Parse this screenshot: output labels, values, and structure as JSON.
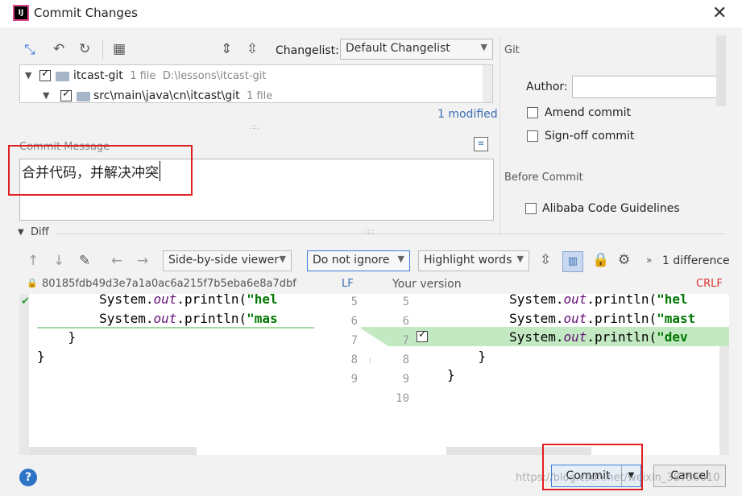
{
  "window": {
    "title": "Commit Changes"
  },
  "toolbar": {
    "changelist_label": "Changelist:",
    "changelist_value": "Default Changelist"
  },
  "git": {
    "section": "Git",
    "author_label": "Author:",
    "author_value": "",
    "amend": "Amend commit",
    "signoff": "Sign-off commit",
    "before_commit": "Before Commit",
    "alibaba": "Alibaba Code Guidelines"
  },
  "tree": {
    "root_name": "itcast-git",
    "root_count": "1 file",
    "root_path": "D:\\lessons\\itcast-git",
    "child_name": "src\\main\\java\\cn\\itcast\\git",
    "child_count": "1 file"
  },
  "modified": "1 modified",
  "commit_message": {
    "label": "Commit Message",
    "value": "合并代码，并解决冲突"
  },
  "diff": {
    "title": "Diff",
    "viewer": "Side-by-side viewer",
    "ignore": "Do not ignore",
    "highlight": "Highlight words",
    "count": "1 difference",
    "left_hash": "80185fdb49d3e7a1a0ac6a215f7b5eba6e8a7dbf",
    "left_eol": "LF",
    "right_title": "Your version",
    "right_eol": "CRLF",
    "left_nums": [
      "5",
      "6",
      "7",
      "8",
      "9"
    ],
    "right_nums": [
      "5",
      "6",
      "7",
      "8",
      "9",
      "10"
    ],
    "left_lines": [
      {
        "pre": "        System.",
        "kw": "out",
        "mid": ".println(",
        "str": "\"hel"
      },
      {
        "pre": "        System.",
        "kw": "out",
        "mid": ".println(",
        "str": "\"mas"
      },
      {
        "pre": "    }",
        "kw": "",
        "mid": "",
        "str": ""
      },
      {
        "pre": "}",
        "kw": "",
        "mid": "",
        "str": ""
      }
    ],
    "right_lines": [
      {
        "pre": "        System.",
        "kw": "out",
        "mid": ".println(",
        "str": "\"hel"
      },
      {
        "pre": "        System.",
        "kw": "out",
        "mid": ".println(",
        "str": "\"mast"
      },
      {
        "pre": "        System.",
        "kw": "out",
        "mid": ".println(",
        "str": "\"dev"
      },
      {
        "pre": "    }",
        "kw": "",
        "mid": "",
        "str": ""
      },
      {
        "pre": "}",
        "kw": "",
        "mid": "",
        "str": ""
      }
    ]
  },
  "buttons": {
    "help": "?",
    "commit": "Commit",
    "cancel": "Cancel"
  },
  "watermark": "https://blog.csdn.net/weixin_38756610"
}
